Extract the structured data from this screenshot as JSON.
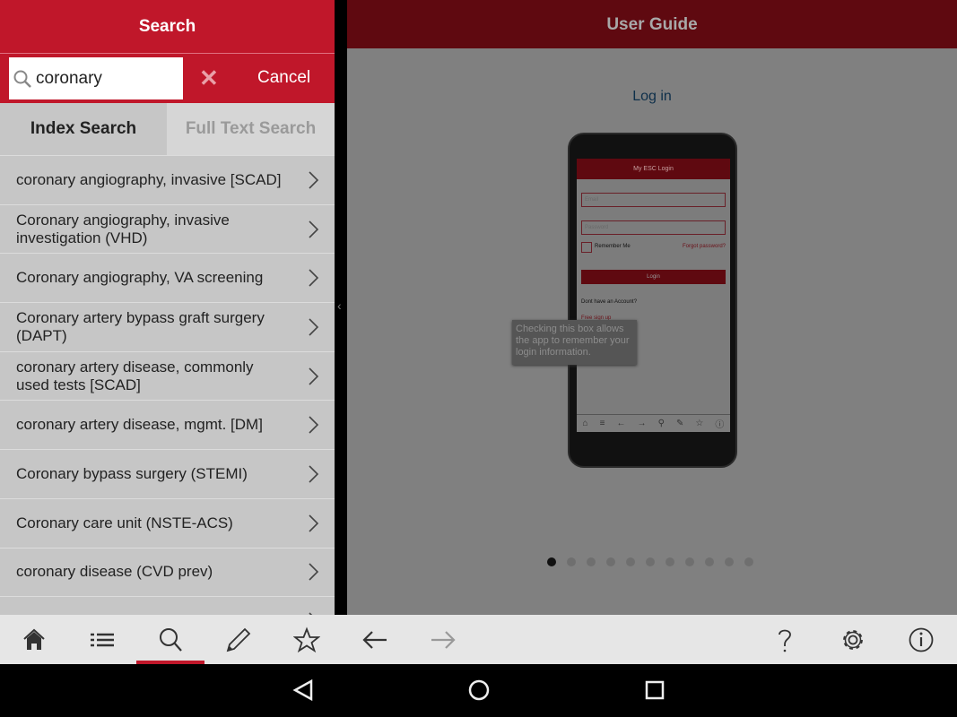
{
  "search": {
    "title": "Search",
    "query": "coronary",
    "cancel_label": "Cancel",
    "tabs": [
      {
        "label": "Index Search",
        "active": true
      },
      {
        "label": "Full Text Search",
        "active": false
      }
    ],
    "results": [
      "coronary angiography, invasive [SCAD]",
      "Coronary angiography, invasive investigation (VHD)",
      "Coronary angiography, VA screening",
      "Coronary artery bypass graft surgery (DAPT)",
      "coronary artery disease, commonly used tests [SCAD]",
      "coronary artery disease, mgmt. [DM]",
      "Coronary bypass surgery (STEMI)",
      "Coronary care unit (NSTE-ACS)",
      "coronary disease (CVD prev)",
      ""
    ]
  },
  "guide": {
    "title": "User Guide",
    "slide_title": "Log in",
    "page": 1,
    "page_count": 11,
    "phone": {
      "title": "My ESC Login",
      "email_placeholder": "Email",
      "password_placeholder": "Password",
      "remember": "Remember Me",
      "forgot": "Forgot password?",
      "login_btn": "Login",
      "no_account": "Dont have an Account?",
      "signup": "Free sign up"
    },
    "tooltip": "Checking this box allows the app to remember your login information."
  },
  "toolbar": {
    "items": [
      "home-icon",
      "list-icon",
      "search-icon",
      "pencil-icon",
      "star-icon",
      "back-arrow-icon",
      "forward-arrow-icon",
      "help-icon",
      "gear-icon",
      "info-icon"
    ],
    "selected": "search-icon"
  },
  "colors": {
    "accent": "#c0172a",
    "dim_accent": "#5f0910"
  }
}
